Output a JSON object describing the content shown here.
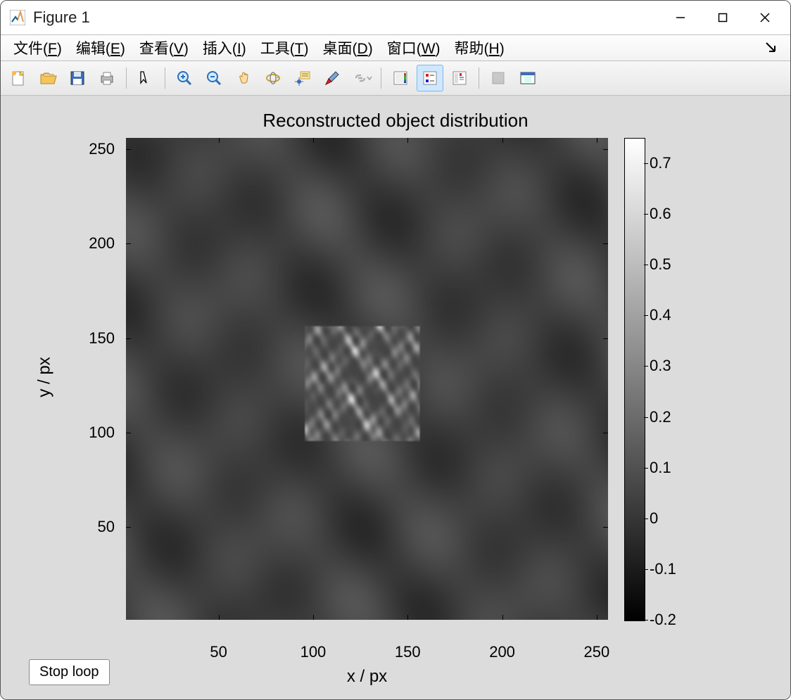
{
  "window": {
    "title": "Figure 1"
  },
  "menu": {
    "file": "文件(F)",
    "edit": "编辑(E)",
    "view": "查看(V)",
    "insert": "插入(I)",
    "tools": "工具(T)",
    "desktop": "桌面(D)",
    "window": "窗口(W)",
    "help": "帮助(H)"
  },
  "toolbar": {
    "new": "new-figure",
    "open": "open-file",
    "save": "save-figure",
    "print": "print-figure",
    "pointer": "edit-plot",
    "zoomin": "zoom-in",
    "zoomout": "zoom-out",
    "pan": "pan",
    "rotate": "rotate-3d",
    "datacursor": "data-cursor",
    "brush": "brush",
    "link": "link-data",
    "colorbar": "insert-colorbar",
    "legend": "insert-legend",
    "hide": "hide-plot-tools",
    "show": "show-plot-tools"
  },
  "chart_data": {
    "type": "heatmap",
    "title": "Reconstructed object distribution",
    "xlabel": "x / px",
    "ylabel": "y / px",
    "xlim": [
      1,
      256
    ],
    "ylim": [
      1,
      256
    ],
    "xticks": [
      50,
      100,
      150,
      200,
      250
    ],
    "yticks": [
      50,
      100,
      150,
      200,
      250
    ],
    "colorbar_range": [
      -0.2,
      0.75
    ],
    "colorbar_ticks": [
      -0.2,
      -0.1,
      0,
      0.1,
      0.2,
      0.3,
      0.4,
      0.5,
      0.6,
      0.7
    ],
    "colormap": "gray",
    "background_noise_range": [
      -0.05,
      0.12
    ],
    "bright_region": {
      "x": [
        95,
        155
      ],
      "y": [
        95,
        155
      ],
      "value_range": [
        0.05,
        0.7
      ]
    }
  },
  "buttons": {
    "stop_loop": "Stop loop"
  }
}
